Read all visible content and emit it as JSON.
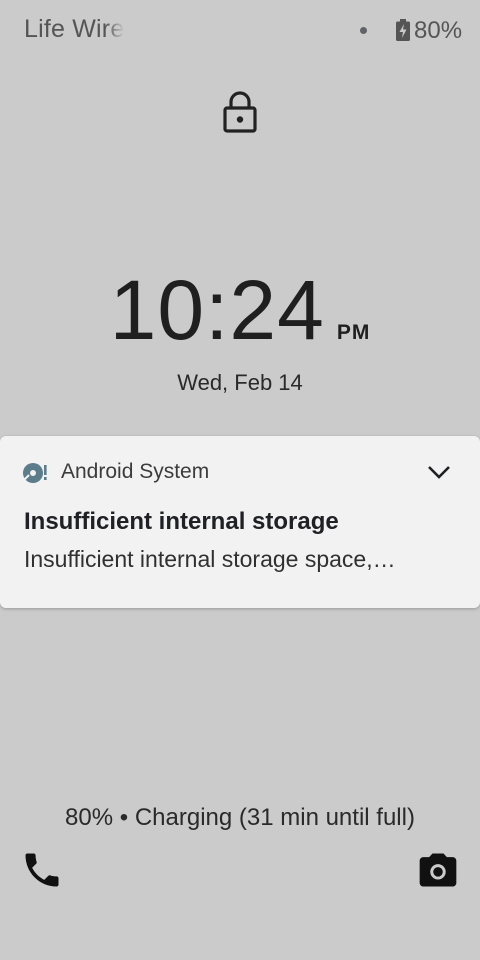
{
  "status_bar": {
    "carrier": "Life Wire",
    "battery_percent": "80%",
    "battery_level": 0.8,
    "icons": [
      "notification-dot-icon",
      "battery-charging-icon"
    ]
  },
  "lock": {
    "icon": "lock-icon"
  },
  "clock": {
    "time": "10:24",
    "ampm": "PM",
    "date": "Wed, Feb 14"
  },
  "notification": {
    "app_icon": "storage-disk-icon",
    "app_name": "Android System",
    "title": "Insufficient internal storage",
    "text": "Insufficient internal storage space,…",
    "expand_icon": "chevron-down-icon"
  },
  "charging": {
    "text": "80% • Charging (31 min until full)"
  },
  "shortcuts": {
    "left_icon": "phone-icon",
    "right_icon": "camera-icon"
  },
  "colors": {
    "background": "#cbcbcb",
    "notification_bg": "#f2f2f2",
    "app_icon_accent": "#5b7c8a"
  }
}
